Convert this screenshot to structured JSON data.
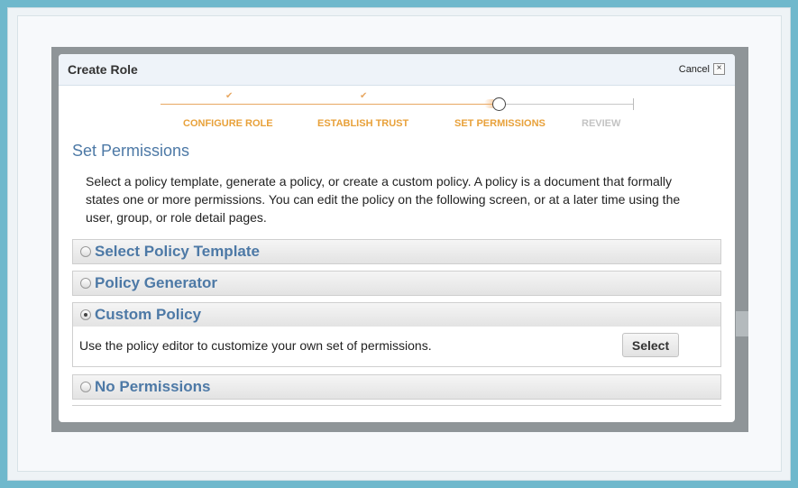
{
  "dialog": {
    "title": "Create Role",
    "cancel_label": "Cancel",
    "close_glyph": "×"
  },
  "wizard": {
    "check_glyph": "✔",
    "steps": [
      {
        "label": "CONFIGURE ROLE",
        "state": "done"
      },
      {
        "label": "ESTABLISH TRUST",
        "state": "done"
      },
      {
        "label": "SET PERMISSIONS",
        "state": "current"
      },
      {
        "label": "REVIEW",
        "state": "todo"
      }
    ]
  },
  "section": {
    "title": "Set Permissions",
    "description": "Select a policy template, generate a policy, or create a custom policy. A policy is a document that formally states one or more permissions. You can edit the policy on the following screen, or at a later time using the user, group, or role detail pages."
  },
  "options": [
    {
      "label": "Select Policy Template",
      "selected": false
    },
    {
      "label": "Policy Generator",
      "selected": false
    },
    {
      "label": "Custom Policy",
      "selected": true
    },
    {
      "label": "No Permissions",
      "selected": false
    }
  ],
  "custom_policy": {
    "body_text": "Use the policy editor to customize your own set of permissions.",
    "button_label": "Select"
  },
  "colors": {
    "accent_orange": "#e8a13a",
    "link_blue": "#4d79a6",
    "inactive_gray": "#c3c3c3"
  }
}
